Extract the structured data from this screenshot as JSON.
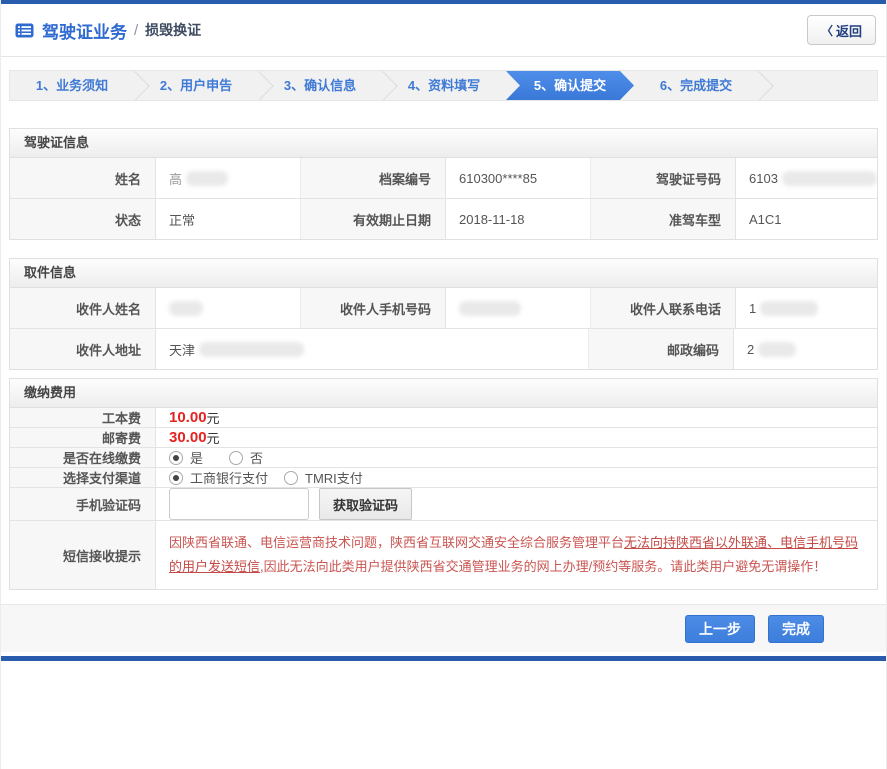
{
  "header": {
    "title": "驾驶证业务",
    "divider": "/",
    "subtitle": "损毁换证",
    "back_icon": "〈",
    "back_label": "返回"
  },
  "steps": [
    {
      "label": "1、业务须知",
      "active": false
    },
    {
      "label": "2、用户申告",
      "active": false
    },
    {
      "label": "3、确认信息",
      "active": false
    },
    {
      "label": "4、资料填写",
      "active": false
    },
    {
      "label": "5、确认提交",
      "active": true
    },
    {
      "label": "6、完成提交",
      "active": false
    }
  ],
  "license": {
    "title": "驾驶证信息",
    "rows": [
      [
        {
          "label": "姓名",
          "value": "高",
          "redacted": true
        },
        {
          "label": "档案编号",
          "value": "610300****85"
        },
        {
          "label": "驾驶证号码",
          "value": "6103",
          "redacted": true
        }
      ],
      [
        {
          "label": "状态",
          "value": "正常"
        },
        {
          "label": "有效期止日期",
          "value": "2018-11-18"
        },
        {
          "label": "准驾车型",
          "value": "A1C1"
        }
      ]
    ]
  },
  "pickup": {
    "title": "取件信息",
    "row1": [
      {
        "label": "收件人姓名",
        "value": "",
        "redacted": true
      },
      {
        "label": "收件人手机号码",
        "value": "",
        "redacted": true
      },
      {
        "label": "收件人联系电话",
        "value": "1",
        "redacted": true
      }
    ],
    "address": {
      "label": "收件人地址",
      "value": "天津",
      "redacted": true
    },
    "postal": {
      "label": "邮政编码",
      "value": "2",
      "redacted": true
    }
  },
  "fees": {
    "title": "缴纳费用",
    "production_fee": {
      "label": "工本费",
      "amount": "10.00",
      "unit": "元"
    },
    "postage_fee": {
      "label": "邮寄费",
      "amount": "30.00",
      "unit": "元"
    },
    "online_payment": {
      "label": "是否在线缴费",
      "yes": "是",
      "no": "否",
      "selected": "是"
    },
    "payment_channel": {
      "label": "选择支付渠道",
      "option1": "工商银行支付",
      "option2": "TMRI支付",
      "selected": "工商银行支付"
    },
    "sms_code": {
      "label": "手机验证码",
      "input_value": "",
      "button": "获取验证码"
    },
    "sms_notice": {
      "label": "短信接收提示",
      "text_before": "因陕西省联通、电信运营商技术问题，陕西省互联网交通安全综合服务管理平台",
      "text_emphasis": "无法向持陕西省以外联通、电信手机号码的用户发送短信,",
      "text_after": "因此无法向此类用户提供陕西省交通管理业务的网上办理/预约等服务。请此类用户避免无谓操作！"
    }
  },
  "footer": {
    "prev": "上一步",
    "finish": "完成"
  },
  "colors": {
    "accent_blue": "#3d7edc",
    "bar_blue": "#2a5cad",
    "fee_red": "#e62222",
    "warning_red": "#ca5551"
  }
}
